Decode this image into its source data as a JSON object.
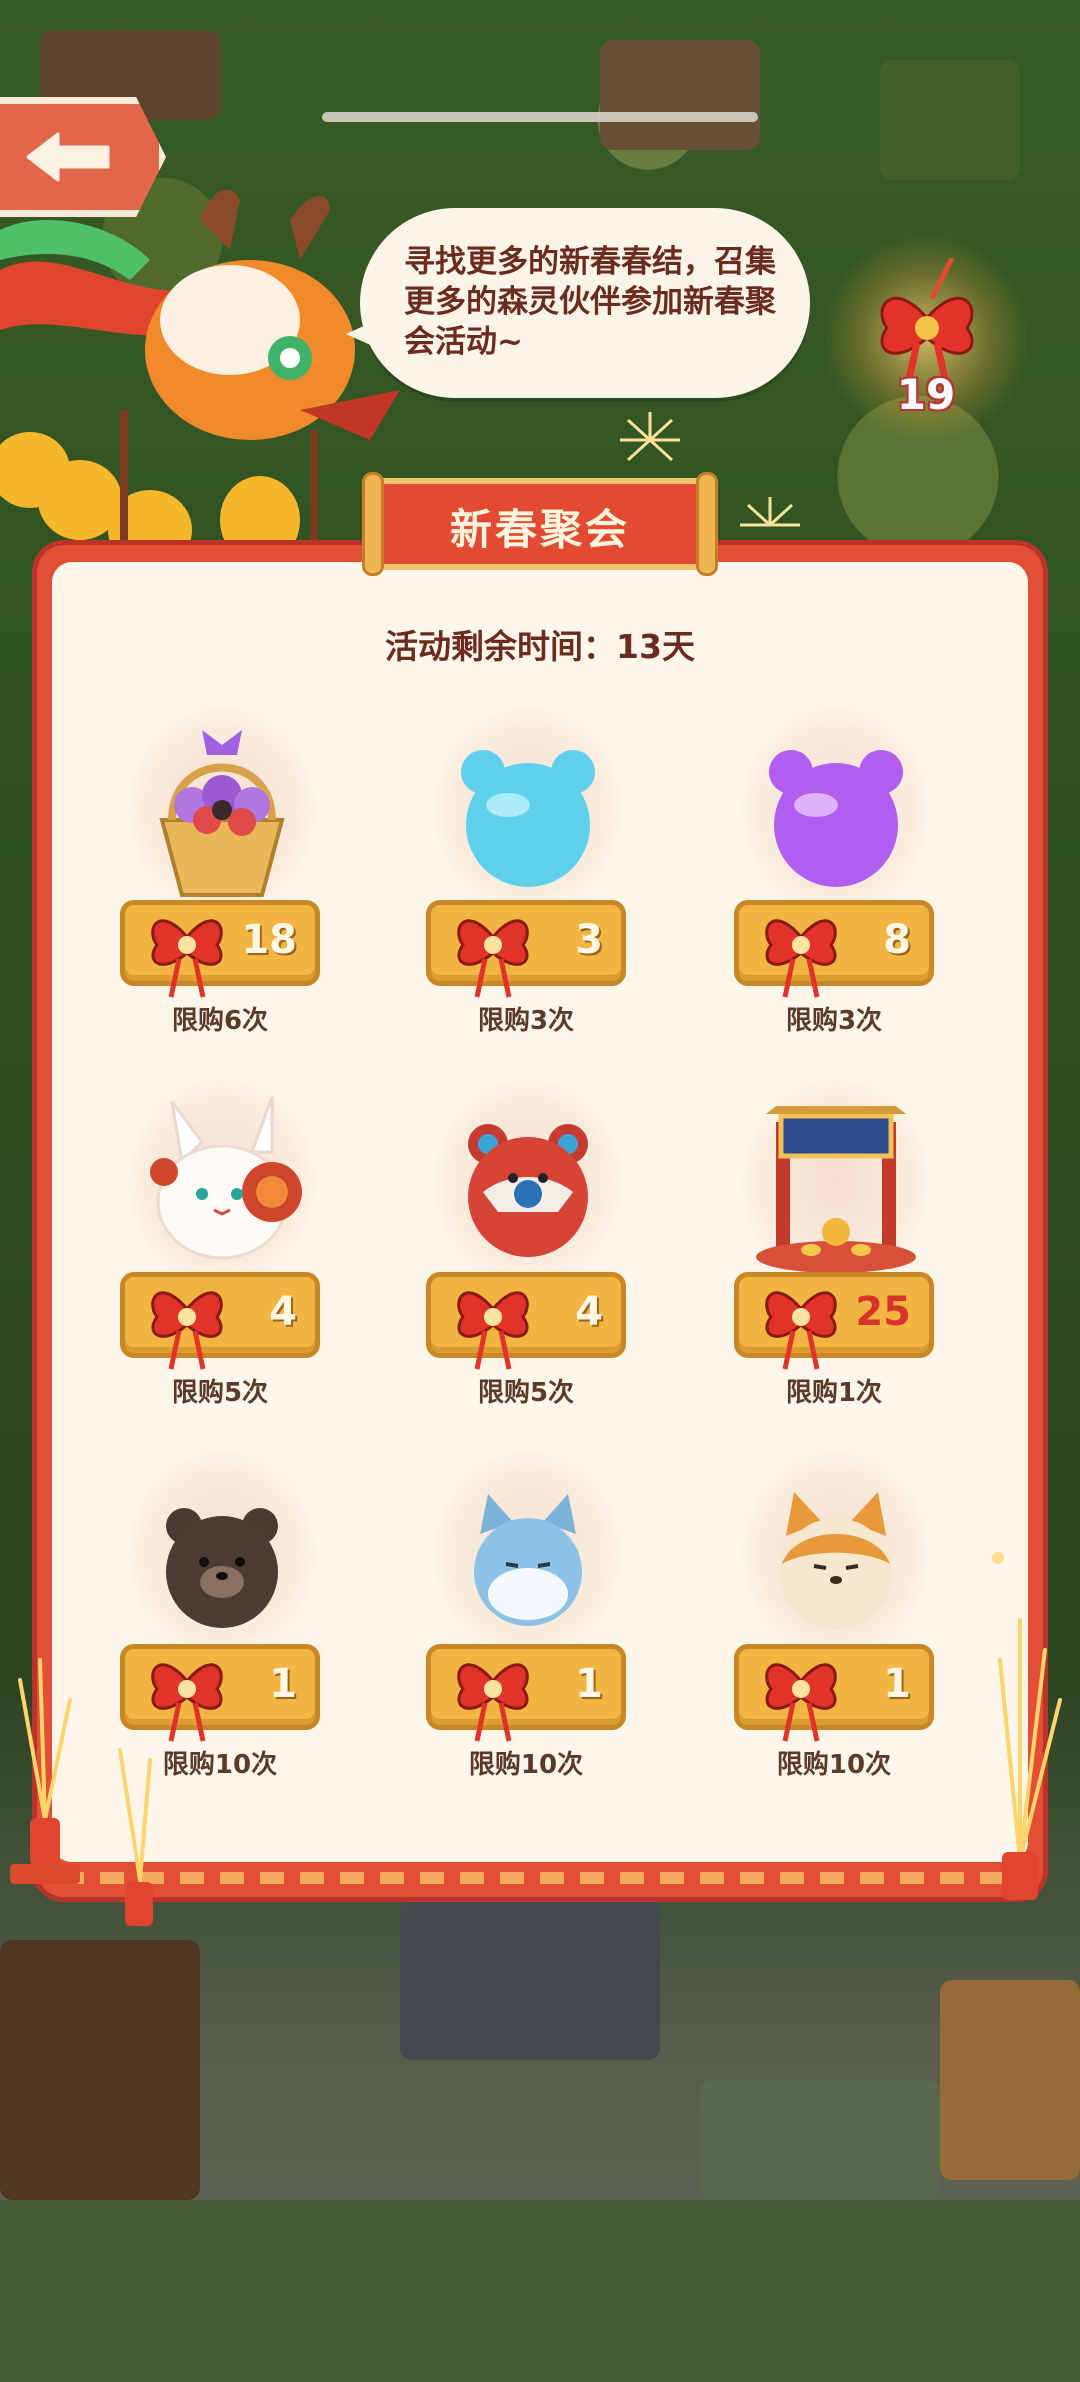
{
  "bubble_text": "寻找更多的新春春结，召集更多的森灵伙伴参加新春聚会活动~",
  "knot_count": "19",
  "panel": {
    "title": "新春聚会",
    "timer": "活动剩余时间：13天"
  },
  "items": [
    {
      "icon": "flower-basket-icon",
      "price": "18",
      "limit": "限购6次"
    },
    {
      "icon": "blue-jelly-bear-icon",
      "price": "3",
      "limit": "限购3次"
    },
    {
      "icon": "purple-jelly-bear-icon",
      "price": "8",
      "limit": "限购3次"
    },
    {
      "icon": "bunny-spirit-icon",
      "price": "4",
      "limit": "限购5次"
    },
    {
      "icon": "red-bear-spirit-icon",
      "price": "4",
      "limit": "限购5次"
    },
    {
      "icon": "festival-gate-icon",
      "price": "25",
      "limit": "限购1次"
    },
    {
      "icon": "brown-bear-spirit-icon",
      "price": "1",
      "limit": "限购10次"
    },
    {
      "icon": "blue-cat-spirit-icon",
      "price": "1",
      "limit": "限购10次"
    },
    {
      "icon": "shiba-spirit-icon",
      "price": "1",
      "limit": "限购10次"
    }
  ],
  "colors": {
    "panel_red": "#e24f35",
    "panel_cream": "#fcf7ea",
    "price_gold": "#f2b541",
    "text_brown": "#6b2b1e"
  }
}
